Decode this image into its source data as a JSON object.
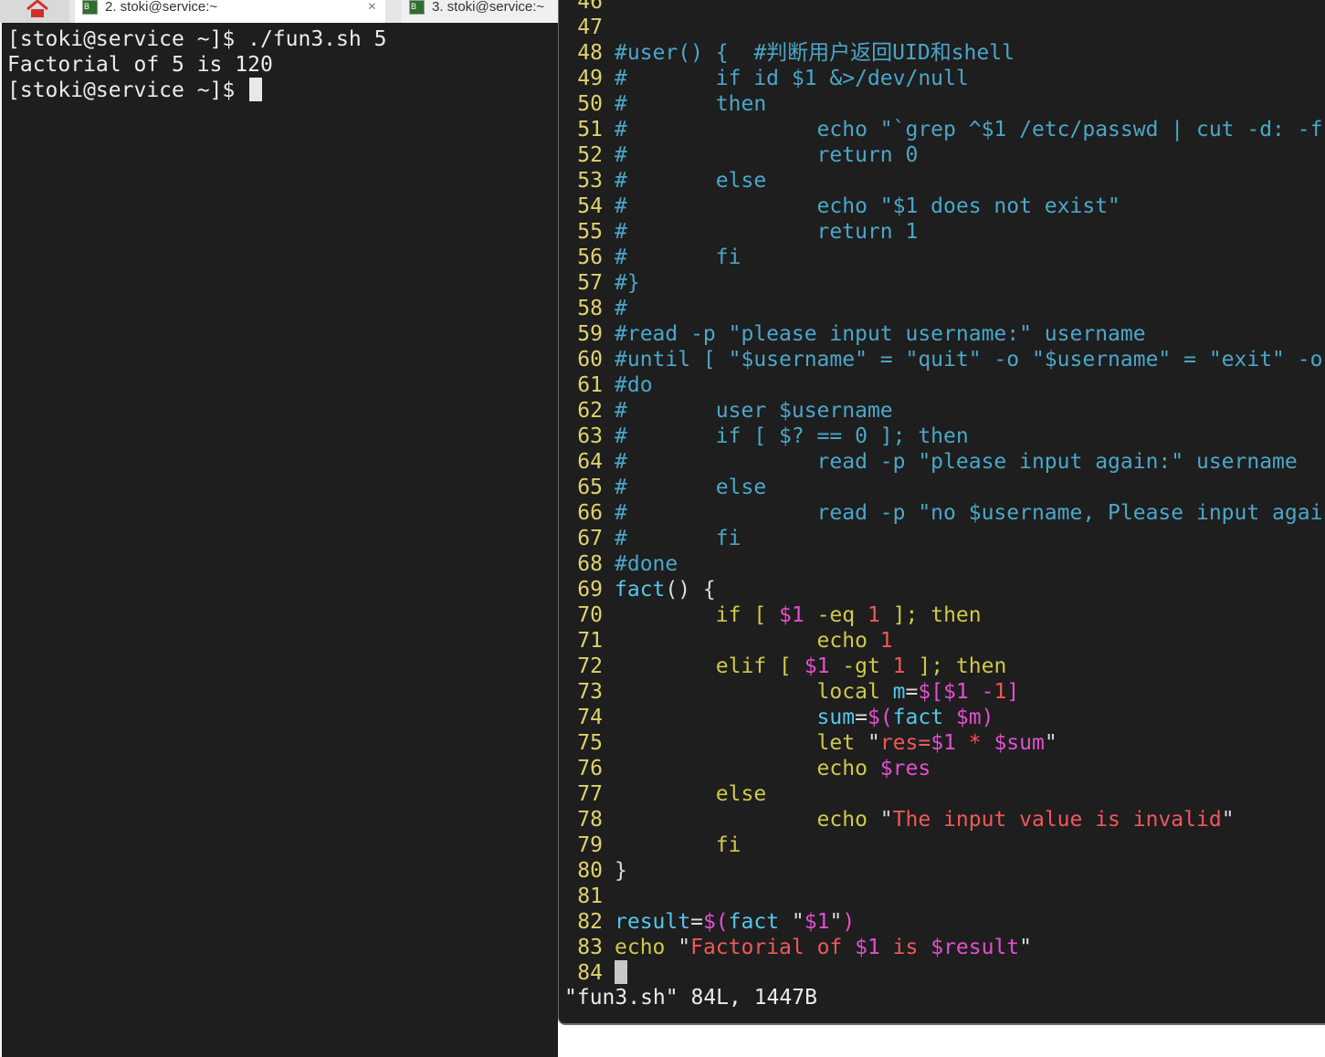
{
  "tabs": [
    {
      "title": "2. stoki@service:~",
      "close": "×"
    },
    {
      "title": "3. stoki@service:~"
    }
  ],
  "left_terminal": {
    "lines": [
      "[stoki@service ~]$ ./fun3.sh 5",
      "Factorial of 5 is 120",
      "[stoki@service ~]$ "
    ]
  },
  "vim": {
    "lines": [
      {
        "n": "46",
        "parts": []
      },
      {
        "n": "47",
        "parts": []
      },
      {
        "n": "48",
        "parts": [
          [
            "c",
            "#user() {  #判断用户返回UID和shell"
          ]
        ]
      },
      {
        "n": "49",
        "parts": [
          [
            "c",
            "#       if id $1 &>/dev/null"
          ]
        ]
      },
      {
        "n": "50",
        "parts": [
          [
            "c",
            "#       then"
          ]
        ]
      },
      {
        "n": "51",
        "parts": [
          [
            "c",
            "#               echo \"`grep ^$1 /etc/passwd | cut -d: -f"
          ]
        ]
      },
      {
        "n": "52",
        "parts": [
          [
            "c",
            "#               return 0"
          ]
        ]
      },
      {
        "n": "53",
        "parts": [
          [
            "c",
            "#       else"
          ]
        ]
      },
      {
        "n": "54",
        "parts": [
          [
            "c",
            "#               echo \"$1 does not exist\""
          ]
        ]
      },
      {
        "n": "55",
        "parts": [
          [
            "c",
            "#               return 1"
          ]
        ]
      },
      {
        "n": "56",
        "parts": [
          [
            "c",
            "#       fi"
          ]
        ]
      },
      {
        "n": "57",
        "parts": [
          [
            "c",
            "#}"
          ]
        ]
      },
      {
        "n": "58",
        "parts": [
          [
            "c",
            "#"
          ]
        ]
      },
      {
        "n": "59",
        "parts": [
          [
            "c",
            "#read -p \"please input username:\" username"
          ]
        ]
      },
      {
        "n": "60",
        "parts": [
          [
            "c",
            "#until [ \"$username\" = \"quit\" -o \"$username\" = \"exit\" -o"
          ]
        ]
      },
      {
        "n": "61",
        "parts": [
          [
            "c",
            "#do"
          ]
        ]
      },
      {
        "n": "62",
        "parts": [
          [
            "c",
            "#       user $username"
          ]
        ]
      },
      {
        "n": "63",
        "parts": [
          [
            "c",
            "#       if [ $? == 0 ]; then"
          ]
        ]
      },
      {
        "n": "64",
        "parts": [
          [
            "c",
            "#               read -p \"please input again:\" username"
          ]
        ]
      },
      {
        "n": "65",
        "parts": [
          [
            "c",
            "#       else"
          ]
        ]
      },
      {
        "n": "66",
        "parts": [
          [
            "c",
            "#               read -p \"no $username, Please input agai"
          ]
        ]
      },
      {
        "n": "67",
        "parts": [
          [
            "c",
            "#       fi"
          ]
        ]
      },
      {
        "n": "68",
        "parts": [
          [
            "c",
            "#done"
          ]
        ]
      },
      {
        "n": "69",
        "parts": [
          [
            "cc",
            "fact"
          ],
          [
            "cw",
            "() {"
          ]
        ]
      },
      {
        "n": "70",
        "parts": [
          [
            "cy",
            "        if [ "
          ],
          [
            "cm",
            "$1"
          ],
          [
            "cy",
            " -eq "
          ],
          [
            "cr",
            "1"
          ],
          [
            "cy",
            " ]; then"
          ]
        ]
      },
      {
        "n": "71",
        "parts": [
          [
            "cy",
            "                echo "
          ],
          [
            "cr",
            "1"
          ]
        ]
      },
      {
        "n": "72",
        "parts": [
          [
            "cy",
            "        elif [ "
          ],
          [
            "cm",
            "$1"
          ],
          [
            "cy",
            " -gt "
          ],
          [
            "cr",
            "1"
          ],
          [
            "cy",
            " ]; then"
          ]
        ]
      },
      {
        "n": "73",
        "parts": [
          [
            "cy",
            "                local "
          ],
          [
            "cc",
            "m"
          ],
          [
            "cw",
            "="
          ],
          [
            "cm",
            "$[$1 -"
          ],
          [
            "cr",
            "1"
          ],
          [
            "cm",
            "]"
          ]
        ]
      },
      {
        "n": "74",
        "parts": [
          [
            "cc",
            "                sum"
          ],
          [
            "cw",
            "="
          ],
          [
            "cm",
            "$("
          ],
          [
            "cc",
            "fact "
          ],
          [
            "cm",
            "$m)"
          ]
        ]
      },
      {
        "n": "75",
        "parts": [
          [
            "cy",
            "                let "
          ],
          [
            "cw",
            "\""
          ],
          [
            "cr",
            "res="
          ],
          [
            "cm",
            "$1"
          ],
          [
            "cr",
            " * "
          ],
          [
            "cm",
            "$sum"
          ],
          [
            "cw",
            "\""
          ]
        ]
      },
      {
        "n": "76",
        "parts": [
          [
            "cy",
            "                echo "
          ],
          [
            "cm",
            "$res"
          ]
        ]
      },
      {
        "n": "77",
        "parts": [
          [
            "cy",
            "        else"
          ]
        ]
      },
      {
        "n": "78",
        "parts": [
          [
            "cy",
            "                echo "
          ],
          [
            "cw",
            "\""
          ],
          [
            "cr",
            "The input value is invalid"
          ],
          [
            "cw",
            "\""
          ]
        ]
      },
      {
        "n": "79",
        "parts": [
          [
            "cy",
            "        fi"
          ]
        ]
      },
      {
        "n": "80",
        "parts": [
          [
            "cw",
            "}"
          ]
        ]
      },
      {
        "n": "81",
        "parts": []
      },
      {
        "n": "82",
        "parts": [
          [
            "cc",
            "result"
          ],
          [
            "cw",
            "="
          ],
          [
            "cm",
            "$("
          ],
          [
            "cc",
            "fact "
          ],
          [
            "cw",
            "\""
          ],
          [
            "cm",
            "$1"
          ],
          [
            "cw",
            "\""
          ],
          [
            "cm",
            ")"
          ]
        ]
      },
      {
        "n": "83",
        "parts": [
          [
            "cy",
            "echo "
          ],
          [
            "cw",
            "\""
          ],
          [
            "cr",
            "Factorial of "
          ],
          [
            "cm",
            "$1"
          ],
          [
            "cr",
            " is "
          ],
          [
            "cm",
            "$result"
          ],
          [
            "cw",
            "\""
          ]
        ]
      },
      {
        "n": "84",
        "parts": []
      }
    ],
    "status": "\"fun3.sh\" 84L, 1447B"
  },
  "colors": {
    "terminal_bg": "#1e1e1e",
    "line_number": "#e0d36b",
    "comment": "#4aa7c9",
    "keyword": "#cfc94a",
    "variable": "#e34fd0",
    "string": "#f0585a",
    "identifier": "#54c7e8"
  },
  "icons": [
    "home-icon",
    "terminal-icon",
    "close-icon"
  ]
}
